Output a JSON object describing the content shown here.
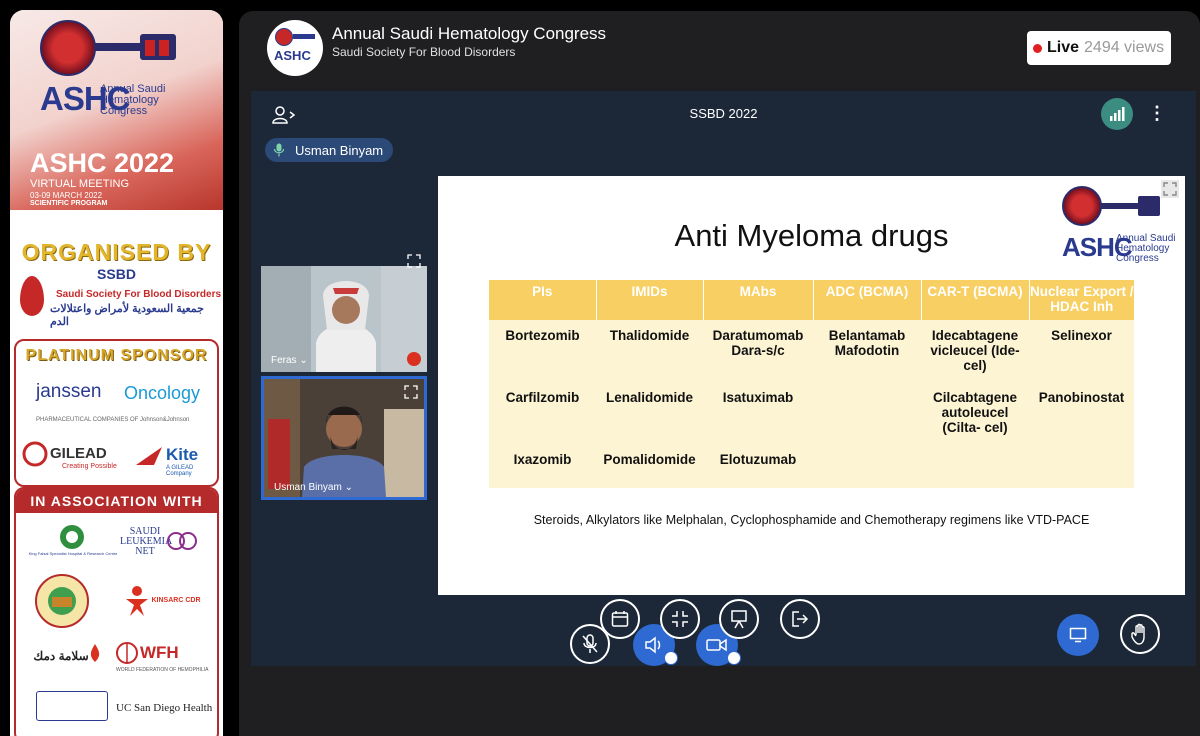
{
  "banner": {
    "logo_text": "ASHC",
    "logo_sub": "Annual Saudi Hematology Congress",
    "year_title": "ASHC 2022",
    "virtual": "VIRTUAL MEETING",
    "dates": "03-09 MARCH 2022",
    "program": "SCIENTIFIC PROGRAM",
    "organised_by": "ORGANISED BY",
    "ssbd": "SSBD",
    "ssbd_full": "Saudi Society For Blood Disorders",
    "ssbd_arabic": "جمعية السعودية لأمراض واعتلالات الدم",
    "platinum_title": "PLATINUM SPONSOR",
    "janssen": "janssen",
    "oncology": "Oncology",
    "jj_note": "PHARMACEUTICAL COMPANIES OF Johnson&Johnson",
    "gilead": "GILEAD",
    "gilead_sub": "Creating Possible",
    "kite": "Kite",
    "kite_sub": "A GILEAD Company",
    "assoc_title": "IN ASSOCIATION WITH",
    "assoc": {
      "saudi_leukemia": "SAUDI LEUKEMIA NET",
      "kfsh": "King Faisal Specialist Hospital & Research Centre",
      "kinsarc": "KINSARC CDR",
      "salama": "سلامة دمك",
      "wfh": "WFH",
      "wfh_sub": "WORLD FEDERATION OF HEMOPHILIA",
      "ucsd": "UC San Diego Health"
    }
  },
  "app": {
    "title": "Annual Saudi Hematology Congress",
    "subtitle": "Saudi Society For Blood Disorders",
    "logo_text": "ASHC",
    "live_label": "Live",
    "views": "2494 views"
  },
  "meeting": {
    "title": "SSBD 2022",
    "active_speaker": "Usman Binyam",
    "tiles": [
      {
        "name": "Feras",
        "chevron": "⌄"
      },
      {
        "name": "Usman Binyam",
        "chevron": "⌄"
      }
    ]
  },
  "slide": {
    "title": "Anti Myeloma drugs",
    "logo_text": "ASHC",
    "logo_sub": "Annual Saudi Hematology Congress",
    "headers": [
      "PIs",
      "IMIDs",
      "MAbs",
      "ADC (BCMA)",
      "CAR-T (BCMA)",
      "Nuclear Export / HDAC Inh"
    ],
    "rows": [
      [
        "Bortezomib",
        "Thalidomide",
        "Daratumomab Dara-s/c",
        "Belantamab Mafodotin",
        "Idecabtagene vicleucel (Ide-cel)",
        "Selinexor"
      ],
      [
        "Carfilzomib",
        "Lenalidomide",
        "Isatuximab",
        "",
        "Cilcabtagene autoleucel (Cilta- cel)",
        "Panobinostat"
      ],
      [
        "Ixazomib",
        "Pomalidomide",
        "Elotuzumab",
        "",
        "",
        ""
      ]
    ],
    "note": "Steroids, Alkylators like Melphalan, Cyclophosphamide and Chemotherapy regimens like VTD-PACE"
  },
  "colors": {
    "table_header": "#f8cf63",
    "table_body": "#fdf4d4",
    "accent_blue": "#2e6ad1",
    "live_dot": "#e02020",
    "signal": "#3a8d80"
  },
  "controls": [
    "mic-off-icon",
    "calendar-icon",
    "speaker-icon",
    "exit-fullscreen-icon",
    "camera-icon",
    "presentation-icon",
    "leave-icon",
    "screen-share-icon",
    "raise-hand-icon"
  ]
}
